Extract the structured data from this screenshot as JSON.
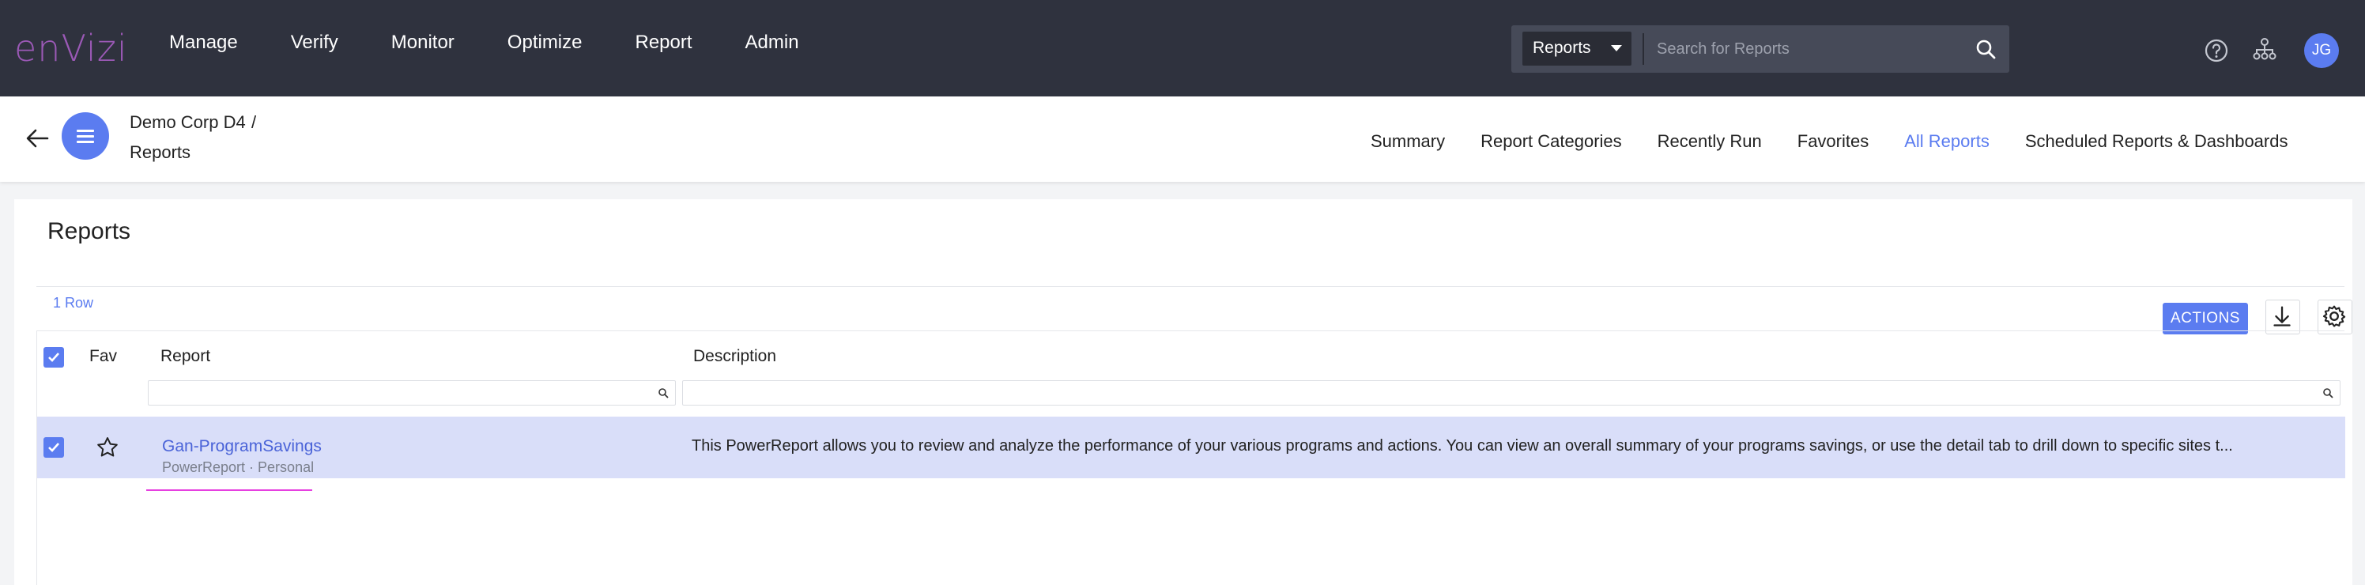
{
  "app": {
    "logo_text": "enVizi"
  },
  "nav": {
    "items": [
      "Manage",
      "Verify",
      "Monitor",
      "Optimize",
      "Report",
      "Admin"
    ]
  },
  "search": {
    "scope_value": "Reports",
    "placeholder": "Search for Reports"
  },
  "user": {
    "initials": "JG"
  },
  "breadcrumb": {
    "parent": "Demo Corp D4",
    "separator": "/",
    "current": "Reports"
  },
  "tabs": [
    {
      "label": "Summary",
      "active": false
    },
    {
      "label": "Report Categories",
      "active": false
    },
    {
      "label": "Recently Run",
      "active": false
    },
    {
      "label": "Favorites",
      "active": false
    },
    {
      "label": "All Reports",
      "active": true
    },
    {
      "label": "Scheduled Reports & Dashboards",
      "active": false
    }
  ],
  "main": {
    "title": "Reports",
    "row_count": "1 Row",
    "actions_label": "ACTIONS"
  },
  "table": {
    "columns": {
      "fav": "Fav",
      "report": "Report",
      "description": "Description"
    },
    "rows": [
      {
        "selected": true,
        "favorite": false,
        "report": "Gan-ProgramSavings",
        "meta": "PowerReport · Personal",
        "description": "This PowerReport allows you to review and analyze the performance of your various programs and actions. You can view an overall summary of your programs savings, or use the detail tab to drill down to specific sites t..."
      }
    ]
  },
  "colors": {
    "topbar": "#2f323e",
    "accent": "#5b7cf0",
    "selected_row": "#d9def9",
    "logo": "#9b59b6"
  },
  "icons": [
    "search-icon",
    "help-icon",
    "org-chart-icon",
    "back-arrow-icon",
    "menu-icon",
    "download-icon",
    "settings-icon",
    "star-icon",
    "check-icon"
  ]
}
